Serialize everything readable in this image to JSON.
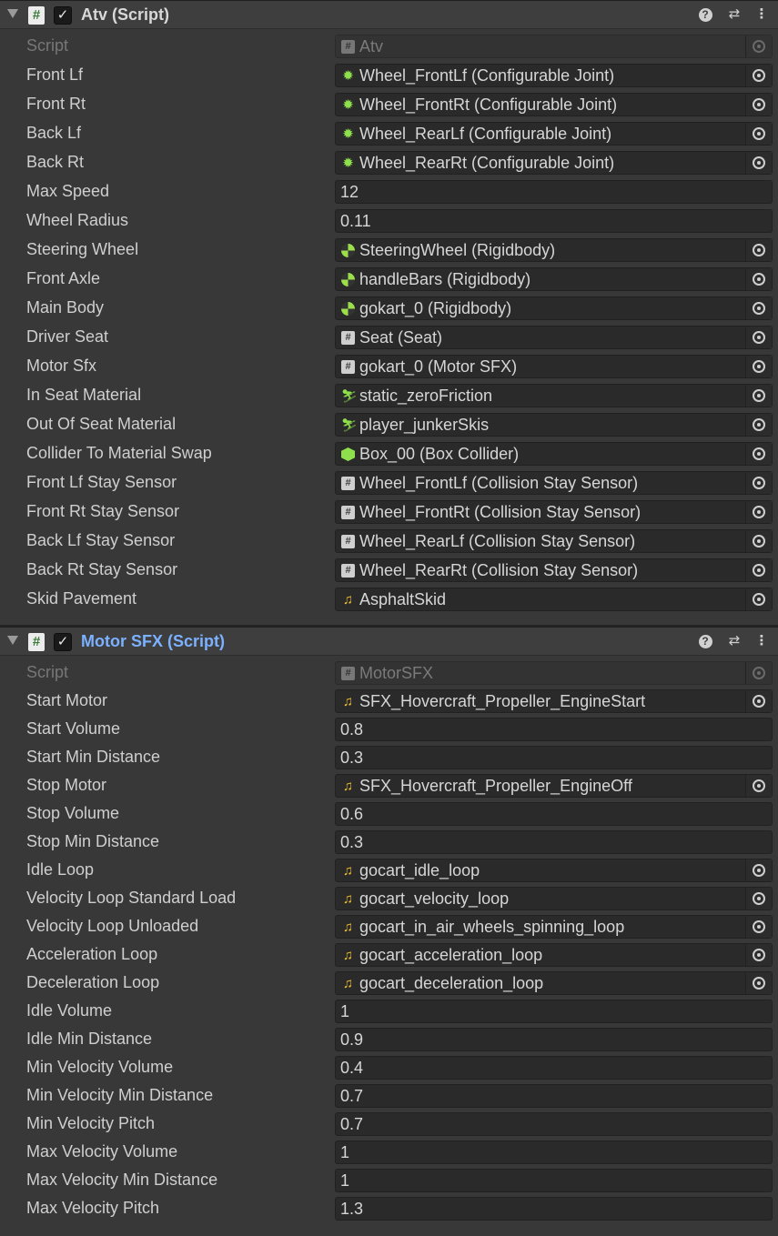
{
  "components": [
    {
      "title": "Atv (Script)",
      "title_color": "#d8d8d8",
      "rows": [
        {
          "label": "Script",
          "value": "Atv",
          "icon": "script-icon",
          "picker": true,
          "disabled": true
        },
        {
          "label": "Front Lf",
          "value": "Wheel_FrontLf (Configurable Joint)",
          "icon": "configurable-joint-icon",
          "picker": true
        },
        {
          "label": "Front Rt",
          "value": "Wheel_FrontRt (Configurable Joint)",
          "icon": "configurable-joint-icon",
          "picker": true
        },
        {
          "label": "Back Lf",
          "value": "Wheel_RearLf (Configurable Joint)",
          "icon": "configurable-joint-icon",
          "picker": true
        },
        {
          "label": "Back Rt",
          "value": "Wheel_RearRt (Configurable Joint)",
          "icon": "configurable-joint-icon",
          "picker": true
        },
        {
          "label": "Max Speed",
          "value": "12"
        },
        {
          "label": "Wheel Radius",
          "value": "0.11"
        },
        {
          "label": "Steering Wheel",
          "value": "SteeringWheel (Rigidbody)",
          "icon": "rigidbody-icon",
          "picker": true
        },
        {
          "label": "Front Axle",
          "value": "handleBars (Rigidbody)",
          "icon": "rigidbody-icon",
          "picker": true
        },
        {
          "label": "Main Body",
          "value": "gokart_0 (Rigidbody)",
          "icon": "rigidbody-icon",
          "picker": true
        },
        {
          "label": "Driver Seat",
          "value": "Seat (Seat)",
          "icon": "script-icon",
          "picker": true
        },
        {
          "label": "Motor Sfx",
          "value": "gokart_0 (Motor SFX)",
          "icon": "script-icon",
          "picker": true
        },
        {
          "label": "In Seat Material",
          "value": "static_zeroFriction",
          "icon": "physic-material-icon",
          "picker": true
        },
        {
          "label": "Out Of Seat Material",
          "value": "player_junkerSkis",
          "icon": "physic-material-icon",
          "picker": true
        },
        {
          "label": "Collider To Material Swap",
          "value": "Box_00 (Box Collider)",
          "icon": "box-collider-icon",
          "picker": true
        },
        {
          "label": "Front Lf Stay Sensor",
          "value": "Wheel_FrontLf (Collision Stay Sensor)",
          "icon": "script-icon",
          "picker": true
        },
        {
          "label": "Front Rt Stay Sensor",
          "value": "Wheel_FrontRt (Collision Stay Sensor)",
          "icon": "script-icon",
          "picker": true
        },
        {
          "label": "Back Lf Stay Sensor",
          "value": "Wheel_RearLf (Collision Stay Sensor)",
          "icon": "script-icon",
          "picker": true
        },
        {
          "label": "Back Rt Stay Sensor",
          "value": "Wheel_RearRt (Collision Stay Sensor)",
          "icon": "script-icon",
          "picker": true
        },
        {
          "label": "Skid Pavement",
          "value": "AsphaltSkid",
          "icon": "audio-clip-icon",
          "picker": true
        }
      ]
    },
    {
      "title": "Motor SFX (Script)",
      "title_color": "#7cb1ff",
      "rows": [
        {
          "label": "Script",
          "value": "MotorSFX",
          "icon": "script-icon",
          "picker": true,
          "disabled": true
        },
        {
          "label": "Start Motor",
          "value": "SFX_Hovercraft_Propeller_EngineStart",
          "icon": "audio-clip-icon",
          "picker": true
        },
        {
          "label": "Start Volume",
          "value": "0.8"
        },
        {
          "label": "Start Min Distance",
          "value": "0.3"
        },
        {
          "label": "Stop Motor",
          "value": "SFX_Hovercraft_Propeller_EngineOff",
          "icon": "audio-clip-icon",
          "picker": true
        },
        {
          "label": "Stop Volume",
          "value": "0.6"
        },
        {
          "label": "Stop Min Distance",
          "value": "0.3"
        },
        {
          "label": "Idle Loop",
          "value": "gocart_idle_loop",
          "icon": "audio-clip-icon",
          "picker": true
        },
        {
          "label": "Velocity Loop Standard Load",
          "value": "gocart_velocity_loop",
          "icon": "audio-clip-icon",
          "picker": true
        },
        {
          "label": "Velocity Loop Unloaded",
          "value": "gocart_in_air_wheels_spinning_loop",
          "icon": "audio-clip-icon",
          "picker": true
        },
        {
          "label": "Acceleration Loop",
          "value": "gocart_acceleration_loop",
          "icon": "audio-clip-icon",
          "picker": true
        },
        {
          "label": "Deceleration Loop",
          "value": "gocart_deceleration_loop",
          "icon": "audio-clip-icon",
          "picker": true
        },
        {
          "label": "Idle Volume",
          "value": "1"
        },
        {
          "label": "Idle Min Distance",
          "value": "0.9"
        },
        {
          "label": "Min Velocity Volume",
          "value": "0.4"
        },
        {
          "label": "Min Velocity Min Distance",
          "value": "0.7"
        },
        {
          "label": "Min Velocity Pitch",
          "value": "0.7"
        },
        {
          "label": "Max Velocity Volume",
          "value": "1"
        },
        {
          "label": "Max Velocity Min Distance",
          "value": "1"
        },
        {
          "label": "Max Velocity Pitch",
          "value": "1.3"
        }
      ]
    }
  ],
  "header_icons": [
    "foldout-arrow-icon",
    "script-icon",
    "enable-checkbox",
    "help-icon",
    "presets-icon",
    "context-menu-icon"
  ],
  "glyphs": {
    "check": "✓",
    "script": "#",
    "joint": "✹",
    "material": "⛷",
    "audio": "♫",
    "help": "?",
    "presets": "⇄",
    "menu": "⋮"
  }
}
